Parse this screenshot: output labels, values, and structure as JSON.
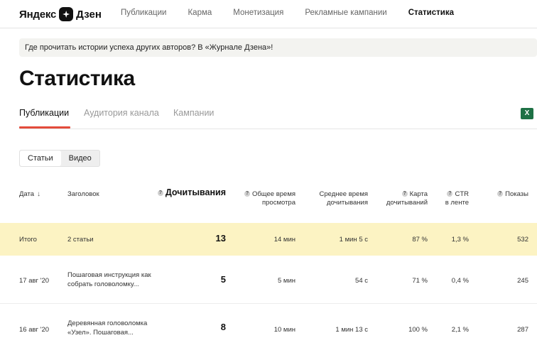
{
  "header": {
    "logo_word": "Яндекс",
    "logo_dzen": "Дзен",
    "nav": [
      "Публикации",
      "Карма",
      "Монетизация",
      "Рекламные кампании",
      "Статистика"
    ],
    "active_nav": "Статистика"
  },
  "banner": {
    "text": "Где прочитать истории успеха других авторов? В «Журнале Дзена»!"
  },
  "page": {
    "title": "Статистика"
  },
  "tabs": [
    "Публикации",
    "Аудитория канала",
    "Кампании"
  ],
  "export_icon": "excel-icon",
  "toggle": [
    "Статьи",
    "Видео"
  ],
  "table": {
    "columns": {
      "date": "Дата",
      "title": "Заголовок",
      "reads": "Дочитывания",
      "total_time_1": "Общее время",
      "total_time_2": "просмотра",
      "avg_time_1": "Среднее время",
      "avg_time_2": "дочитывания",
      "map_1": "Карта",
      "map_2": "дочитываний",
      "ctr_1": "CTR",
      "ctr_2": "в ленте",
      "views": "Показы"
    },
    "total": {
      "label": "Итого",
      "title": "2 статьи",
      "reads": "13",
      "total_time": "14 мин",
      "avg_time": "1 мин 5 с",
      "map": "87 %",
      "ctr": "1,3 %",
      "views": "532"
    },
    "rows": [
      {
        "date": "17 авг '20",
        "title_1": "Пошаговая инструкция как",
        "title_2": "собрать головоломку...",
        "reads": "5",
        "total_time": "5 мин",
        "avg_time": "54 с",
        "map": "71 %",
        "ctr": "0,4 %",
        "views": "245"
      },
      {
        "date": "16 авг '20",
        "title_1": "Деревянная головоломка",
        "title_2": "«Узел». Пошаговая...",
        "reads": "8",
        "total_time": "10 мин",
        "avg_time": "1 мин 13 с",
        "map": "100 %",
        "ctr": "2,1 %",
        "views": "287"
      }
    ]
  },
  "colors": {
    "accent": "#e34b3b",
    "total_row_bg": "#fcf3c3",
    "excel_green": "#1e7145"
  }
}
